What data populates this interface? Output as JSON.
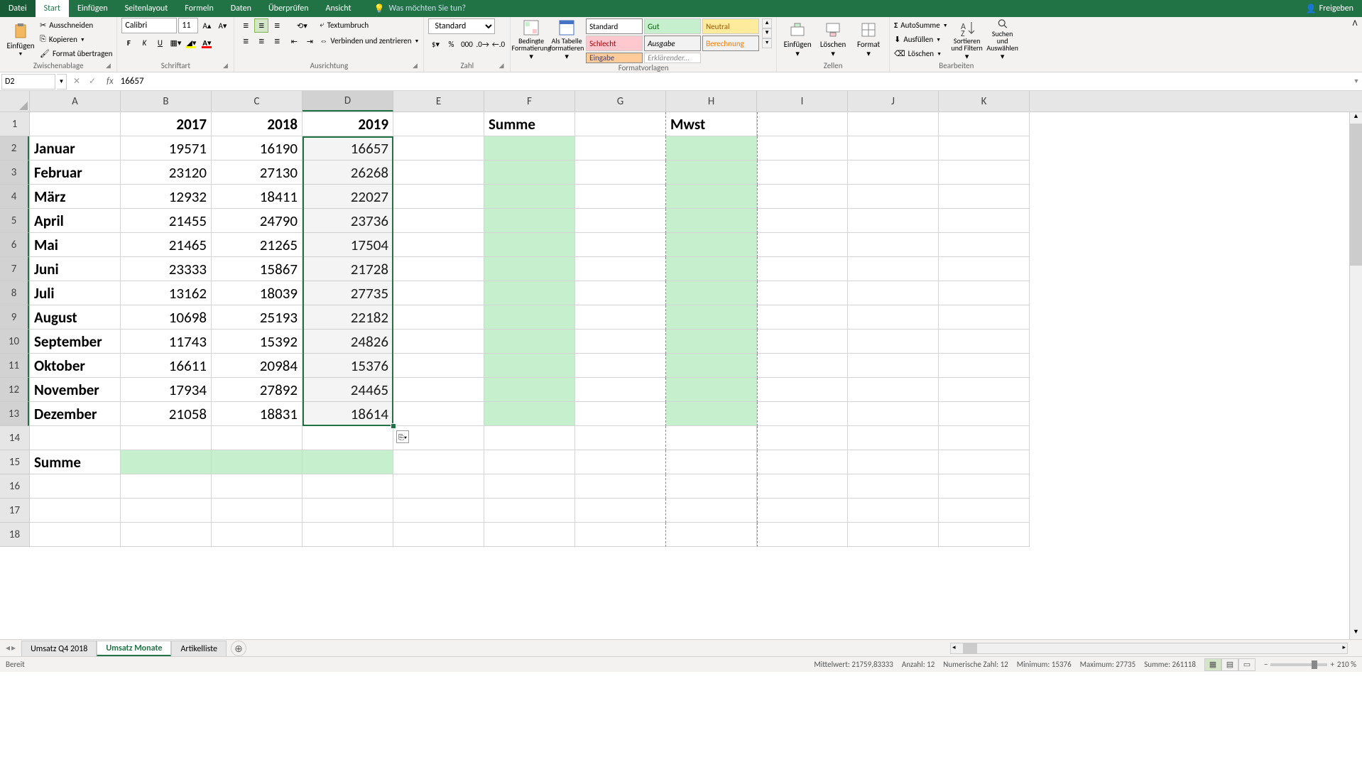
{
  "titlebar": {
    "file": "Datei",
    "tabs": [
      "Start",
      "Einfügen",
      "Seitenlayout",
      "Formeln",
      "Daten",
      "Überprüfen",
      "Ansicht"
    ],
    "active_tab": "Start",
    "search_placeholder": "Was möchten Sie tun?",
    "share": "Freigeben"
  },
  "ribbon": {
    "clipboard": {
      "paste": "Einfügen",
      "cut": "Ausschneiden",
      "copy": "Kopieren",
      "format_painter": "Format übertragen",
      "group": "Zwischenablage"
    },
    "font": {
      "name": "Calibri",
      "size": "11",
      "group": "Schriftart"
    },
    "alignment": {
      "wrap": "Textumbruch",
      "merge": "Verbinden und zentrieren",
      "group": "Ausrichtung"
    },
    "number": {
      "format": "Standard",
      "group": "Zahl"
    },
    "styles": {
      "cond": "Bedingte Formatierung",
      "table": "Als Tabelle formatieren",
      "standard": "Standard",
      "gut": "Gut",
      "neutral": "Neutral",
      "schlecht": "Schlecht",
      "ausgabe": "Ausgabe",
      "berechnung": "Berechnung",
      "eingabe": "Eingabe",
      "erkl": "Erklärender...",
      "group": "Formatvorlagen"
    },
    "cells": {
      "insert": "Einfügen",
      "delete": "Löschen",
      "format": "Format",
      "group": "Zellen"
    },
    "editing": {
      "autosum": "AutoSumme",
      "fill": "Ausfüllen",
      "clear": "Löschen",
      "sort": "Sortieren und Filtern",
      "find": "Suchen und Auswählen",
      "group": "Bearbeiten"
    }
  },
  "formula_bar": {
    "name_box": "D2",
    "formula": "16657"
  },
  "columns": [
    "A",
    "B",
    "C",
    "D",
    "E",
    "F",
    "G",
    "H",
    "I",
    "J",
    "K"
  ],
  "rows": [
    1,
    2,
    3,
    4,
    5,
    6,
    7,
    8,
    9,
    10,
    11,
    12,
    13,
    14,
    15,
    16,
    17,
    18
  ],
  "selected_col": "D",
  "selected_rows": [
    2,
    3,
    4,
    5,
    6,
    7,
    8,
    9,
    10,
    11,
    12,
    13
  ],
  "headers": {
    "B": "2017",
    "C": "2018",
    "D": "2019",
    "F": "Summe",
    "H": "Mwst"
  },
  "months": [
    "Januar",
    "Februar",
    "März",
    "April",
    "Mai",
    "Juni",
    "Juli",
    "August",
    "September",
    "Oktober",
    "November",
    "Dezember"
  ],
  "data_2017": [
    19571,
    23120,
    12932,
    21455,
    21465,
    23333,
    13162,
    10698,
    11743,
    16611,
    17934,
    21058
  ],
  "data_2018": [
    16190,
    27130,
    18411,
    24790,
    21265,
    15867,
    18039,
    25193,
    15392,
    20984,
    27892,
    18831
  ],
  "data_2019": [
    16657,
    26268,
    22027,
    23736,
    17504,
    21728,
    27735,
    22182,
    24826,
    15376,
    24465,
    18614
  ],
  "summe_label": "Summe",
  "sheets": {
    "tabs": [
      "Umsatz Q4 2018",
      "Umsatz Monate",
      "Artikelliste"
    ],
    "active": "Umsatz Monate"
  },
  "status": {
    "ready": "Bereit",
    "mittelwert": "Mittelwert: 21759,83333",
    "anzahl": "Anzahl: 12",
    "numerische": "Numerische Zahl: 12",
    "minimum": "Minimum: 15376",
    "maximum": "Maximum: 27735",
    "summe": "Summe: 261118",
    "zoom": "210 %"
  }
}
